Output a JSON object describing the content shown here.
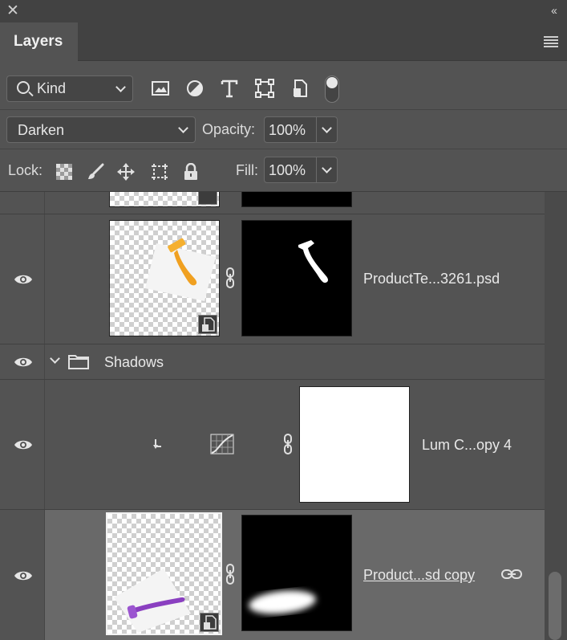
{
  "window": {
    "close_glyph": "✕",
    "collapse_glyph": "‹‹"
  },
  "panel": {
    "tab_label": "Layers"
  },
  "filter": {
    "kind_label": "Kind",
    "icons": [
      "image-filter-icon",
      "adjustment-filter-icon",
      "type-filter-icon",
      "shape-filter-icon",
      "smart-object-filter-icon"
    ]
  },
  "blend": {
    "mode": "Darken",
    "opacity_label": "Opacity:",
    "opacity_value": "100%"
  },
  "lock": {
    "label": "Lock:",
    "fill_label": "Fill:",
    "fill_value": "100%",
    "icons": [
      "lock-transparent-pixels-icon",
      "lock-image-pixels-icon",
      "lock-position-icon",
      "lock-artboard-icon",
      "lock-all-icon"
    ]
  },
  "layers": [
    {
      "name": "",
      "type": "smart-object-partial",
      "visible": true
    },
    {
      "name": "ProductTe...3261.psd",
      "type": "smart-object",
      "visible": true,
      "colors": {
        "product": "#f0a020"
      }
    },
    {
      "name": "Shadows",
      "type": "group",
      "visible": true,
      "expanded": true
    },
    {
      "name": "Lum C...opy 4",
      "type": "curves-adjustment",
      "visible": true,
      "clipped": true
    },
    {
      "name": "Product...sd copy",
      "type": "smart-object",
      "visible": true,
      "selected": true,
      "linked": true,
      "colors": {
        "product": "#8a3fc0"
      }
    }
  ],
  "colors": {
    "panel_bg": "#535353",
    "header_bg": "#424242",
    "selected_row": "#696969"
  }
}
